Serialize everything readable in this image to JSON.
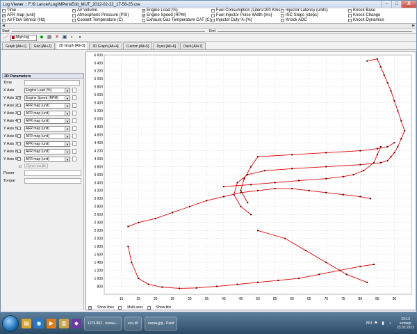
{
  "window": {
    "title": "Log Viewer :: F:\\9 Lancer\\Log\\MPerisEdit_MUT_2012-02-22_17-58-25.csv",
    "buttons": [
      "–",
      "□",
      "X"
    ]
  },
  "params": {
    "col1": [
      {
        "label": "Time",
        "checked": false
      },
      {
        "label": "AFR map (unit)",
        "checked": true
      },
      {
        "label": "Air Flow Sensor (Hz)",
        "checked": false
      }
    ],
    "col2": [
      {
        "label": "Air Volume",
        "checked": false
      },
      {
        "label": "Atmospheric Pressure (PSI)",
        "checked": false
      },
      {
        "label": "Coolant Temperature (C)",
        "checked": false
      }
    ],
    "col3": [
      {
        "label": "Engine Load (%)",
        "checked": true
      },
      {
        "label": "Engine Speed (RPM)",
        "checked": true
      },
      {
        "label": "Exhaust Gas Temperature CAT (C)",
        "checked": false
      }
    ],
    "col4": [
      {
        "label": "Fuel Consumption (Liters/100 Kms)",
        "checked": false
      },
      {
        "label": "Fuel Injector Pulse Width (ms)",
        "checked": false
      },
      {
        "label": "Injector Duty % (%)",
        "checked": false
      }
    ],
    "col5": [
      {
        "label": "Injector Latency (units)",
        "checked": false
      },
      {
        "label": "ISC Steps (steps)",
        "checked": false
      },
      {
        "label": "Knock ADC",
        "checked": false
      }
    ],
    "col6": [
      {
        "label": "Knock Base",
        "checked": false
      },
      {
        "label": "Knock Change",
        "checked": false
      },
      {
        "label": "Knock Dynamics",
        "checked": false
      }
    ]
  },
  "range": {
    "start_label": "Start",
    "end_label": "End"
  },
  "toolbar": {
    "log_name": "Main log"
  },
  "tabs": [
    {
      "label": "Graph [Alt+1]",
      "active": false
    },
    {
      "label": "Grid [Alt+2]",
      "active": false
    },
    {
      "label": "2D Graph [Alt+3]",
      "active": true
    },
    {
      "label": "3D Graph [Alt+4]",
      "active": false
    },
    {
      "label": "Custom [Alt+5]",
      "active": false
    },
    {
      "label": "Dyno [Alt+6]",
      "active": false
    },
    {
      "label": "Dash [Alt+7]",
      "active": false
    }
  ],
  "left_panel": {
    "header": "2D Parameters",
    "time_label": "Time",
    "xaxis_label": "X Axis",
    "xaxis_value": "Engine Load (%)",
    "yaxes": [
      {
        "label": "Y Axis 1",
        "checked": true,
        "value": "Engine Speed (RPM)"
      },
      {
        "label": "Y Axis 2",
        "checked": false,
        "value": "AFR map (unit)"
      },
      {
        "label": "Y Axis 3",
        "checked": false,
        "value": "AFR map (unit)"
      },
      {
        "label": "Y Axis 4",
        "checked": false,
        "value": "AFR map (unit)"
      },
      {
        "label": "Y Axis 5",
        "checked": false,
        "value": "AFR map (unit)"
      },
      {
        "label": "Y Axis 6",
        "checked": false,
        "value": "AFR map (unit)"
      },
      {
        "label": "Y Axis 7",
        "checked": false,
        "value": "AFR map (unit)"
      },
      {
        "label": "Y Axis 8",
        "checked": false,
        "value": "AFR map (unit)"
      },
      {
        "label": "Y Axis 9",
        "checked": false,
        "value": "AFR map (unit)"
      }
    ],
    "dyno_label": "Dyno results",
    "power_label": "Power",
    "torque_label": "Torque"
  },
  "bottom": {
    "show_lines": "Show lines",
    "multi_axes": "Multi axes",
    "show_title": "Show title"
  },
  "taskbar": {
    "tasks": [
      "1279.862 - полны...",
      "ecu.dll",
      "схема.jpg - Paint"
    ],
    "clock_time": "22:13",
    "clock_day": "четверг",
    "clock_date": "23.02.2012"
  },
  "colors": {
    "series": "#e00000",
    "point": "#4a0000"
  },
  "chart_data": {
    "type": "scatter",
    "title": "",
    "xlabel": "",
    "ylabel": "",
    "xlim": [
      5,
      95
    ],
    "ylim": [
      600,
      6600
    ],
    "x_ticks": [
      10,
      15,
      20,
      25,
      30,
      35,
      40,
      45,
      50,
      55,
      60,
      65,
      70,
      75,
      80,
      85,
      90
    ],
    "y_ticks": [
      800,
      1000,
      1200,
      1400,
      1600,
      1800,
      2000,
      2200,
      2400,
      2600,
      2800,
      3000,
      3200,
      3400,
      3600,
      3800,
      4000,
      4200,
      4400,
      4600,
      4800,
      5000,
      5200,
      5400,
      5600,
      5800,
      6000,
      6200,
      6400,
      6600
    ],
    "grid": true,
    "series": [
      {
        "x": [
          82,
          85,
          86,
          87,
          88,
          89,
          90,
          91,
          92,
          93,
          92,
          91,
          90,
          89,
          88,
          86,
          80,
          70,
          60,
          52,
          47,
          44,
          43,
          45,
          48
        ],
        "y": [
          6450,
          6500,
          6300,
          6100,
          5900,
          5700,
          5450,
          5200,
          4950,
          4700,
          4500,
          4300,
          4150,
          4050,
          3950,
          3900,
          3850,
          3800,
          3750,
          3700,
          3600,
          3400,
          3100,
          2800,
          2600
        ]
      },
      {
        "x": [
          90,
          88,
          85,
          80,
          70,
          60,
          50,
          48,
          46,
          45,
          47
        ],
        "y": [
          4400,
          4300,
          4250,
          4200,
          4150,
          4100,
          4050,
          3800,
          3500,
          3200,
          2900
        ]
      },
      {
        "x": [
          40,
          48,
          55,
          62,
          70,
          75,
          78,
          81,
          84,
          85,
          86
        ],
        "y": [
          3300,
          3350,
          3400,
          3450,
          3500,
          3550,
          3600,
          3700,
          3900,
          4100,
          4300
        ]
      },
      {
        "x": [
          12,
          15,
          20,
          25,
          30,
          35,
          40,
          45,
          50,
          55,
          60,
          65,
          70,
          75,
          80,
          83
        ],
        "y": [
          2300,
          2400,
          2500,
          2650,
          2800,
          2950,
          3050,
          3150,
          3200,
          3250,
          3250,
          3200,
          3150,
          3100,
          3050,
          3000
        ]
      },
      {
        "x": [
          12,
          13,
          15,
          18,
          22,
          27,
          32,
          38,
          44,
          50,
          56,
          62,
          68,
          74,
          80,
          84
        ],
        "y": [
          1800,
          1400,
          1000,
          850,
          780,
          750,
          760,
          800,
          850,
          900,
          950,
          1000,
          1100,
          1200,
          1300,
          1350
        ]
      },
      {
        "x": [
          50,
          58,
          64,
          70,
          76,
          82
        ],
        "y": [
          2200,
          2000,
          1700,
          1400,
          1100,
          900
        ]
      }
    ]
  }
}
